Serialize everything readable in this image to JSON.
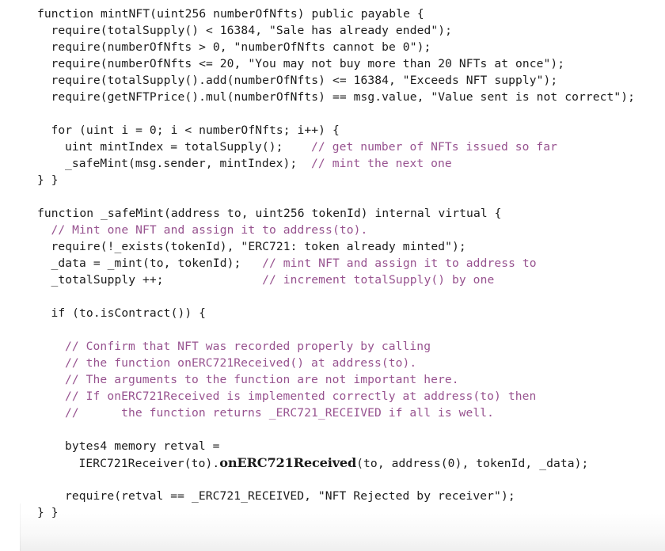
{
  "document": {
    "kind": "code-listing",
    "language": "Solidity",
    "colors": {
      "background": "#ffffff",
      "code_text": "#1b1b1b",
      "comment": "#97528f"
    },
    "lines": [
      {
        "indent": 0,
        "segments": [
          {
            "text": "function mintNFT(uint256 numberOfNfts) public payable {",
            "style": "code"
          }
        ]
      },
      {
        "indent": 1,
        "segments": [
          {
            "text": "require(totalSupply() < 16384, \"Sale has already ended\");",
            "style": "code"
          }
        ]
      },
      {
        "indent": 1,
        "segments": [
          {
            "text": "require(numberOfNfts > 0, \"numberOfNfts cannot be 0\");",
            "style": "code"
          }
        ]
      },
      {
        "indent": 1,
        "segments": [
          {
            "text": "require(numberOfNfts <= 20, \"You may not buy more than 20 NFTs at once\");",
            "style": "code"
          }
        ]
      },
      {
        "indent": 1,
        "segments": [
          {
            "text": "require(totalSupply().add(numberOfNfts) <= 16384, \"Exceeds NFT supply\");",
            "style": "code"
          }
        ]
      },
      {
        "indent": 1,
        "segments": [
          {
            "text": "require(getNFTPrice().mul(numberOfNfts) == msg.value, \"Value sent is not correct\");",
            "style": "code"
          }
        ]
      },
      {
        "indent": 0,
        "segments": [
          {
            "text": "",
            "style": "blank"
          }
        ]
      },
      {
        "indent": 1,
        "segments": [
          {
            "text": "for (uint i = 0; i < numberOfNfts; i++) {",
            "style": "code"
          }
        ]
      },
      {
        "indent": 2,
        "segments": [
          {
            "text": "uint mintIndex = totalSupply();    ",
            "style": "code"
          },
          {
            "text": "// get number of NFTs issued so far",
            "style": "comment"
          }
        ]
      },
      {
        "indent": 2,
        "segments": [
          {
            "text": "_safeMint(msg.sender, mintIndex);  ",
            "style": "code"
          },
          {
            "text": "// mint the next one",
            "style": "comment"
          }
        ]
      },
      {
        "indent": 0,
        "segments": [
          {
            "text": "} }",
            "style": "code"
          }
        ]
      },
      {
        "indent": 0,
        "segments": [
          {
            "text": "",
            "style": "blank"
          }
        ]
      },
      {
        "indent": 0,
        "segments": [
          {
            "text": "function _safeMint(address to, uint256 tokenId) internal virtual {",
            "style": "code"
          }
        ]
      },
      {
        "indent": 1,
        "segments": [
          {
            "text": "// Mint one NFT and assign it to address(to).",
            "style": "comment"
          }
        ]
      },
      {
        "indent": 1,
        "segments": [
          {
            "text": "require(!_exists(tokenId), \"ERC721: token already minted\");",
            "style": "code"
          }
        ]
      },
      {
        "indent": 1,
        "segments": [
          {
            "text": "_data = _mint(to, tokenId);   ",
            "style": "code"
          },
          {
            "text": "// mint NFT and assign it to address to",
            "style": "comment"
          }
        ]
      },
      {
        "indent": 1,
        "segments": [
          {
            "text": "_totalSupply ++;              ",
            "style": "code"
          },
          {
            "text": "// increment totalSupply() by one",
            "style": "comment"
          }
        ]
      },
      {
        "indent": 0,
        "segments": [
          {
            "text": "",
            "style": "blank"
          }
        ]
      },
      {
        "indent": 1,
        "segments": [
          {
            "text": "if (to.isContract()) {",
            "style": "code"
          }
        ]
      },
      {
        "indent": 0,
        "segments": [
          {
            "text": "",
            "style": "blank"
          }
        ]
      },
      {
        "indent": 2,
        "segments": [
          {
            "text": "// Confirm that NFT was recorded properly by calling",
            "style": "comment"
          }
        ]
      },
      {
        "indent": 2,
        "segments": [
          {
            "text": "// the function onERC721Received() at address(to).",
            "style": "comment"
          }
        ]
      },
      {
        "indent": 2,
        "segments": [
          {
            "text": "// The arguments to the function are not important here.",
            "style": "comment"
          }
        ]
      },
      {
        "indent": 2,
        "segments": [
          {
            "text": "// If onERC721Received is implemented correctly at address(to) then",
            "style": "comment"
          }
        ]
      },
      {
        "indent": 2,
        "segments": [
          {
            "text": "//      the function returns _ERC721_RECEIVED if all is well.",
            "style": "comment"
          }
        ]
      },
      {
        "indent": 0,
        "segments": [
          {
            "text": "",
            "style": "blank"
          }
        ]
      },
      {
        "indent": 2,
        "segments": [
          {
            "text": "bytes4 memory retval =",
            "style": "code"
          }
        ]
      },
      {
        "indent": 3,
        "segments": [
          {
            "text": "IERC721Receiver(to).",
            "style": "code"
          },
          {
            "text": "onERC721Received",
            "style": "serif"
          },
          {
            "text": "(to, address(0), tokenId, _data);",
            "style": "code"
          }
        ]
      },
      {
        "indent": 0,
        "segments": [
          {
            "text": "",
            "style": "blank"
          }
        ]
      },
      {
        "indent": 2,
        "segments": [
          {
            "text": "require(retval == _ERC721_RECEIVED, \"NFT Rejected by receiver\");",
            "style": "code"
          }
        ]
      },
      {
        "indent": 0,
        "segments": [
          {
            "text": "} }",
            "style": "code"
          }
        ]
      }
    ]
  }
}
